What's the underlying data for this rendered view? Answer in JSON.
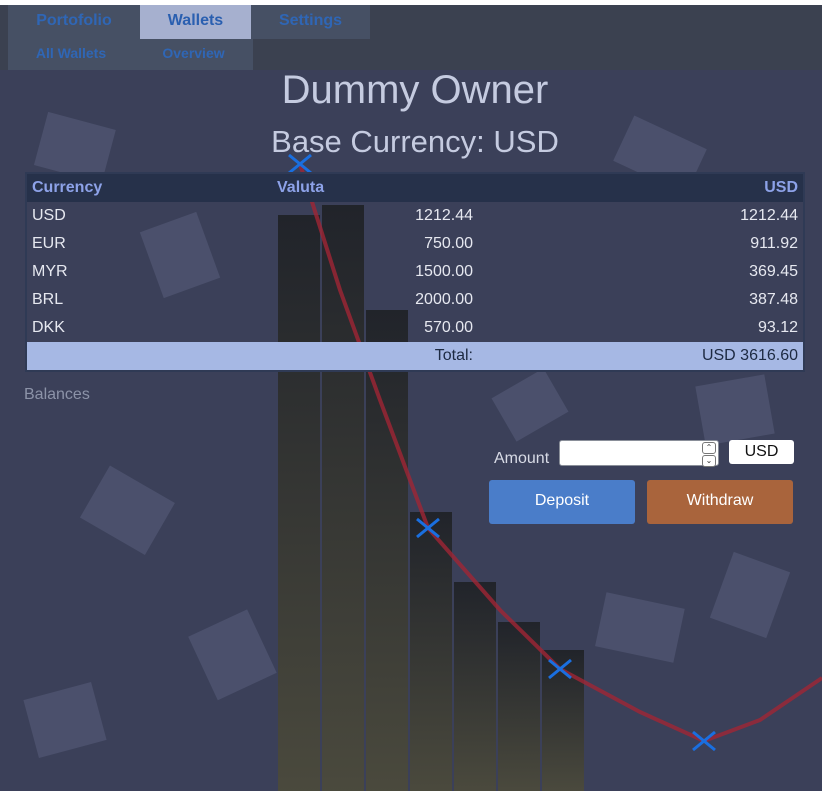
{
  "nav": {
    "main_tabs": [
      "Portofolio",
      "Wallets",
      "Settings"
    ],
    "sub_tabs": [
      "All Wallets",
      "Overview"
    ]
  },
  "owner_name": "Dummy Owner",
  "base_currency_label": "Base Currency: USD",
  "table": {
    "headers": [
      "Currency",
      "Valuta",
      "USD"
    ],
    "rows": [
      [
        "USD",
        "1212.44",
        "1212.44"
      ],
      [
        "EUR",
        "750.00",
        "911.92"
      ],
      [
        "MYR",
        "1500.00",
        "369.45"
      ],
      [
        "BRL",
        "2000.00",
        "387.48"
      ],
      [
        "DKK",
        "570.00",
        "93.12"
      ]
    ],
    "total_label": "Total:",
    "total_value": "USD 3616.60"
  },
  "balances_label": "Balances",
  "form": {
    "amount_label": "Amount",
    "amount_value": "",
    "currency": "USD",
    "deposit": "Deposit",
    "withdraw": "Withdraw"
  },
  "colors": {
    "accent": "#2f66b5",
    "deposit": "#4a7dc9",
    "withdraw": "#a9643c",
    "line": "#a02535",
    "marker": "#1a6fe0"
  }
}
